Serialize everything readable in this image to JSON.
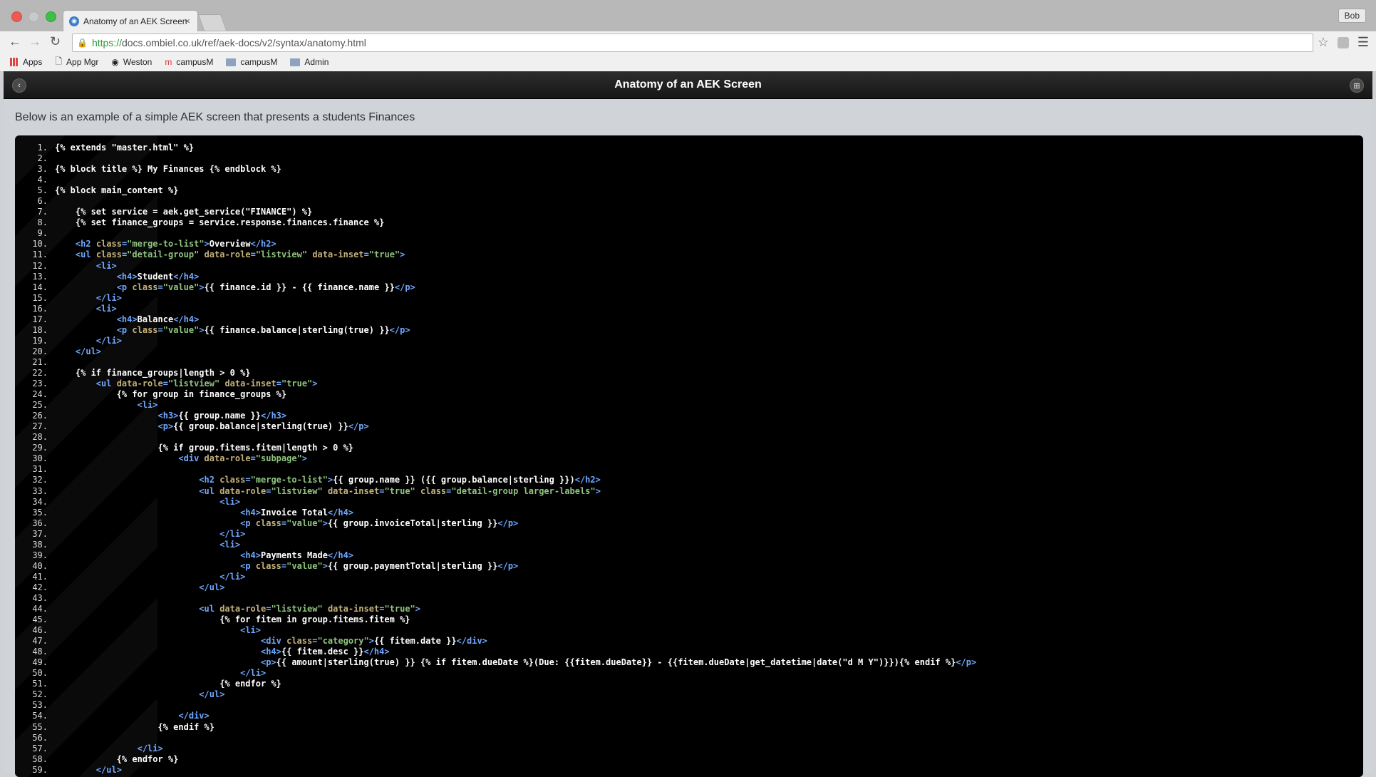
{
  "browser": {
    "tab_title": "Anatomy of an AEK Screen",
    "tab_close": "×",
    "profile": "Bob",
    "url_scheme": "https://",
    "url_rest": "docs.ombiel.co.uk/ref/aek-docs/v2/syntax/anatomy.html",
    "bookmarks": [
      "Apps",
      "App Mgr",
      "Weston",
      "campusM",
      "campusM",
      "Admin"
    ]
  },
  "page": {
    "header_title": "Anatomy of an AEK Screen",
    "intro": "Below is an example of a simple AEK screen that presents a students Finances"
  },
  "code_lines": [
    [
      [
        "t",
        "{% extends \"master.html\" %}"
      ]
    ],
    [],
    [
      [
        "t",
        "{% block title %} My Finances {% endblock %}"
      ]
    ],
    [],
    [
      [
        "t",
        "{% block main_content %}"
      ]
    ],
    [],
    [
      [
        "t",
        "    {% set service = aek.get_service(\"FINANCE\") %}"
      ]
    ],
    [
      [
        "t",
        "    {% set finance_groups = service.response.finances.finance %}"
      ]
    ],
    [],
    [
      [
        "t",
        "    "
      ],
      [
        "g",
        "<h2 "
      ],
      [
        "a",
        "class"
      ],
      [
        "g",
        "="
      ],
      [
        "v",
        "\"merge-to-list\""
      ],
      [
        "g",
        ">"
      ],
      [
        "t",
        "Overview"
      ],
      [
        "g",
        "</h2>"
      ]
    ],
    [
      [
        "t",
        "    "
      ],
      [
        "g",
        "<ul "
      ],
      [
        "a",
        "class"
      ],
      [
        "g",
        "="
      ],
      [
        "v",
        "\"detail-group\""
      ],
      [
        "t",
        " "
      ],
      [
        "a",
        "data-role"
      ],
      [
        "g",
        "="
      ],
      [
        "v",
        "\"listview\""
      ],
      [
        "t",
        " "
      ],
      [
        "a",
        "data-inset"
      ],
      [
        "g",
        "="
      ],
      [
        "v",
        "\"true\""
      ],
      [
        "g",
        ">"
      ]
    ],
    [
      [
        "t",
        "        "
      ],
      [
        "g",
        "<li>"
      ]
    ],
    [
      [
        "t",
        "            "
      ],
      [
        "g",
        "<h4>"
      ],
      [
        "t",
        "Student"
      ],
      [
        "g",
        "</h4>"
      ]
    ],
    [
      [
        "t",
        "            "
      ],
      [
        "g",
        "<p "
      ],
      [
        "a",
        "class"
      ],
      [
        "g",
        "="
      ],
      [
        "v",
        "\"value\""
      ],
      [
        "g",
        ">"
      ],
      [
        "t",
        "{{ finance.id }} - {{ finance.name }}"
      ],
      [
        "g",
        "</p>"
      ]
    ],
    [
      [
        "t",
        "        "
      ],
      [
        "g",
        "</li>"
      ]
    ],
    [
      [
        "t",
        "        "
      ],
      [
        "g",
        "<li>"
      ]
    ],
    [
      [
        "t",
        "            "
      ],
      [
        "g",
        "<h4>"
      ],
      [
        "t",
        "Balance"
      ],
      [
        "g",
        "</h4>"
      ]
    ],
    [
      [
        "t",
        "            "
      ],
      [
        "g",
        "<p "
      ],
      [
        "a",
        "class"
      ],
      [
        "g",
        "="
      ],
      [
        "v",
        "\"value\""
      ],
      [
        "g",
        ">"
      ],
      [
        "t",
        "{{ finance.balance|sterling(true) }}"
      ],
      [
        "g",
        "</p>"
      ]
    ],
    [
      [
        "t",
        "        "
      ],
      [
        "g",
        "</li>"
      ]
    ],
    [
      [
        "t",
        "    "
      ],
      [
        "g",
        "</ul>"
      ]
    ],
    [],
    [
      [
        "t",
        "    {% if finance_groups|length > 0 %}"
      ]
    ],
    [
      [
        "t",
        "        "
      ],
      [
        "g",
        "<ul "
      ],
      [
        "a",
        "data-role"
      ],
      [
        "g",
        "="
      ],
      [
        "v",
        "\"listview\""
      ],
      [
        "t",
        " "
      ],
      [
        "a",
        "data-inset"
      ],
      [
        "g",
        "="
      ],
      [
        "v",
        "\"true\""
      ],
      [
        "g",
        ">"
      ]
    ],
    [
      [
        "t",
        "            {% for group in finance_groups %}"
      ]
    ],
    [
      [
        "t",
        "                "
      ],
      [
        "g",
        "<li>"
      ]
    ],
    [
      [
        "t",
        "                    "
      ],
      [
        "g",
        "<h3>"
      ],
      [
        "t",
        "{{ group.name }}"
      ],
      [
        "g",
        "</h3>"
      ]
    ],
    [
      [
        "t",
        "                    "
      ],
      [
        "g",
        "<p>"
      ],
      [
        "t",
        "{{ group.balance|sterling(true) }}"
      ],
      [
        "g",
        "</p>"
      ]
    ],
    [],
    [
      [
        "t",
        "                    {% if group.fitems.fitem|length > 0 %}"
      ]
    ],
    [
      [
        "t",
        "                        "
      ],
      [
        "g",
        "<div "
      ],
      [
        "a",
        "data-role"
      ],
      [
        "g",
        "="
      ],
      [
        "v",
        "\"subpage\""
      ],
      [
        "g",
        ">"
      ]
    ],
    [],
    [
      [
        "t",
        "                            "
      ],
      [
        "g",
        "<h2 "
      ],
      [
        "a",
        "class"
      ],
      [
        "g",
        "="
      ],
      [
        "v",
        "\"merge-to-list\""
      ],
      [
        "g",
        ">"
      ],
      [
        "t",
        "{{ group.name }} ({{ group.balance|sterling }})"
      ],
      [
        "g",
        "</h2>"
      ]
    ],
    [
      [
        "t",
        "                            "
      ],
      [
        "g",
        "<ul "
      ],
      [
        "a",
        "data-role"
      ],
      [
        "g",
        "="
      ],
      [
        "v",
        "\"listview\""
      ],
      [
        "t",
        " "
      ],
      [
        "a",
        "data-inset"
      ],
      [
        "g",
        "="
      ],
      [
        "v",
        "\"true\""
      ],
      [
        "t",
        " "
      ],
      [
        "a",
        "class"
      ],
      [
        "g",
        "="
      ],
      [
        "v",
        "\"detail-group larger-labels\""
      ],
      [
        "g",
        ">"
      ]
    ],
    [
      [
        "t",
        "                                "
      ],
      [
        "g",
        "<li>"
      ]
    ],
    [
      [
        "t",
        "                                    "
      ],
      [
        "g",
        "<h4>"
      ],
      [
        "t",
        "Invoice Total"
      ],
      [
        "g",
        "</h4>"
      ]
    ],
    [
      [
        "t",
        "                                    "
      ],
      [
        "g",
        "<p "
      ],
      [
        "a",
        "class"
      ],
      [
        "g",
        "="
      ],
      [
        "v",
        "\"value\""
      ],
      [
        "g",
        ">"
      ],
      [
        "t",
        "{{ group.invoiceTotal|sterling }}"
      ],
      [
        "g",
        "</p>"
      ]
    ],
    [
      [
        "t",
        "                                "
      ],
      [
        "g",
        "</li>"
      ]
    ],
    [
      [
        "t",
        "                                "
      ],
      [
        "g",
        "<li>"
      ]
    ],
    [
      [
        "t",
        "                                    "
      ],
      [
        "g",
        "<h4>"
      ],
      [
        "t",
        "Payments Made"
      ],
      [
        "g",
        "</h4>"
      ]
    ],
    [
      [
        "t",
        "                                    "
      ],
      [
        "g",
        "<p "
      ],
      [
        "a",
        "class"
      ],
      [
        "g",
        "="
      ],
      [
        "v",
        "\"value\""
      ],
      [
        "g",
        ">"
      ],
      [
        "t",
        "{{ group.paymentTotal|sterling }}"
      ],
      [
        "g",
        "</p>"
      ]
    ],
    [
      [
        "t",
        "                                "
      ],
      [
        "g",
        "</li>"
      ]
    ],
    [
      [
        "t",
        "                            "
      ],
      [
        "g",
        "</ul>"
      ]
    ],
    [],
    [
      [
        "t",
        "                            "
      ],
      [
        "g",
        "<ul "
      ],
      [
        "a",
        "data-role"
      ],
      [
        "g",
        "="
      ],
      [
        "v",
        "\"listview\""
      ],
      [
        "t",
        " "
      ],
      [
        "a",
        "data-inset"
      ],
      [
        "g",
        "="
      ],
      [
        "v",
        "\"true\""
      ],
      [
        "g",
        ">"
      ]
    ],
    [
      [
        "t",
        "                                {% for fitem in group.fitems.fitem %}"
      ]
    ],
    [
      [
        "t",
        "                                    "
      ],
      [
        "g",
        "<li>"
      ]
    ],
    [
      [
        "t",
        "                                        "
      ],
      [
        "g",
        "<div "
      ],
      [
        "a",
        "class"
      ],
      [
        "g",
        "="
      ],
      [
        "v",
        "\"category\""
      ],
      [
        "g",
        ">"
      ],
      [
        "t",
        "{{ fitem.date }}"
      ],
      [
        "g",
        "</div>"
      ]
    ],
    [
      [
        "t",
        "                                        "
      ],
      [
        "g",
        "<h4>"
      ],
      [
        "t",
        "{{ fitem.desc }}"
      ],
      [
        "g",
        "</h4>"
      ]
    ],
    [
      [
        "t",
        "                                        "
      ],
      [
        "g",
        "<p>"
      ],
      [
        "t",
        "{{ amount|sterling(true) }} {% if fitem.dueDate %}(Due: {{fitem.dueDate}} - {{fitem.dueDate|get_datetime|date(\"d M Y\")}}){% endif %}"
      ],
      [
        "g",
        "</p>"
      ]
    ],
    [
      [
        "t",
        "                                    "
      ],
      [
        "g",
        "</li>"
      ]
    ],
    [
      [
        "t",
        "                                {% endfor %}"
      ]
    ],
    [
      [
        "t",
        "                            "
      ],
      [
        "g",
        "</ul>"
      ]
    ],
    [],
    [
      [
        "t",
        "                        "
      ],
      [
        "g",
        "</div>"
      ]
    ],
    [
      [
        "t",
        "                    {% endif %}"
      ]
    ],
    [],
    [
      [
        "t",
        "                "
      ],
      [
        "g",
        "</li>"
      ]
    ],
    [
      [
        "t",
        "            {% endfor %}"
      ]
    ],
    [
      [
        "t",
        "        "
      ],
      [
        "g",
        "</ul>"
      ]
    ]
  ]
}
